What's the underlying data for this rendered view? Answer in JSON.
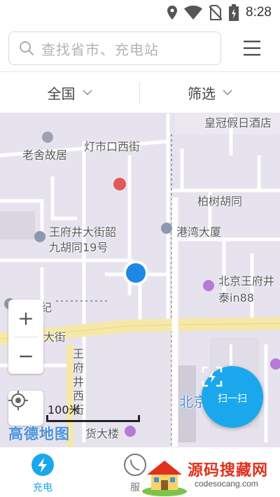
{
  "status_bar": {
    "time": "8:28",
    "icons": [
      "location-icon",
      "wifi-icon",
      "no-sim-icon",
      "battery-charging-icon"
    ]
  },
  "search": {
    "placeholder": "查找省市、充电站",
    "icon": "search-icon"
  },
  "menu": {
    "icon": "menu-icon"
  },
  "filters": {
    "region_label": "全国",
    "filter_label": "筛选",
    "icon": "chevron-down-icon"
  },
  "map": {
    "labels": {
      "hotel": "皇冠假日酒店",
      "old_residence": "老舍故居",
      "street_top": "灯市口西街",
      "hutong_baishu": "柏树胡同",
      "hk_building": "港湾大厦",
      "wfj_hutong": "王府井大街韶",
      "wfj_hutong_2": "九胡同19号",
      "mall": "北京王府井",
      "mall_2": "泰in88",
      "century": "新世纪",
      "big_street": "大街",
      "wfj_west_1": "王",
      "wfj_west_2": "府",
      "wfj_west_3": "井",
      "wfj_west_4": "西",
      "wfj_west_5": "街",
      "dept_store": "货大楼",
      "beijing": "北京"
    },
    "scale": "100米",
    "logo": "高德地图",
    "user_location_color": "#1e88e5"
  },
  "scan_button": {
    "label": "扫一扫",
    "color": "#1aa7ec"
  },
  "tabs": [
    {
      "label": "充电",
      "icon": "lightning-icon",
      "active": true,
      "color": "#1aa7ec"
    },
    {
      "label": "服",
      "icon": "service-icon",
      "active": false,
      "color": "#777777"
    }
  ],
  "watermark": {
    "title": "源码搜藏网",
    "domain": "codesocang.com"
  }
}
